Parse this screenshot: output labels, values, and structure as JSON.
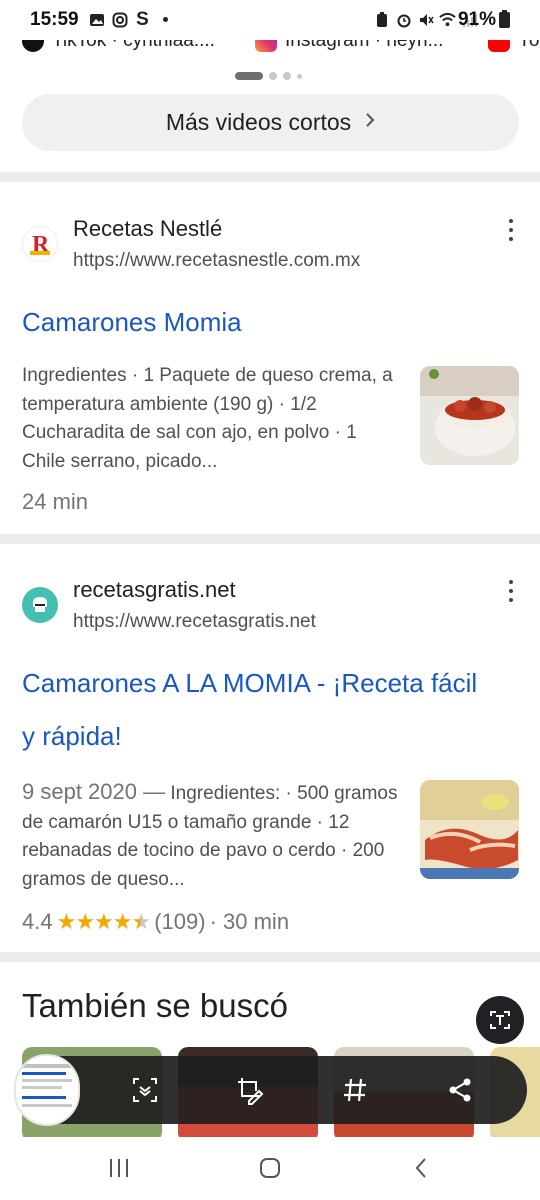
{
  "status_bar": {
    "time": "15:59",
    "battery": "91%"
  },
  "social_row": {
    "items": [
      {
        "label": "TikTok · cynthiaa....",
        "icon": "tiktok-icon"
      },
      {
        "label": "Instagram · neyn...",
        "icon": "instagram-icon"
      },
      {
        "label": "Yo",
        "icon": "youtube-icon"
      }
    ]
  },
  "more_videos": {
    "label": "Más videos cortos"
  },
  "results": [
    {
      "site_name": "Recetas Nestlé",
      "url": "https://www.recetasnestle.com.mx",
      "title": "Camarones Momia",
      "snippet": "Ingredientes · 1 Paquete de queso crema, a temperatura ambiente (190 g) · 1/2 Cucharadita de sal con ajo, en polvo · 1 Chile serrano, picado...",
      "meta": "24 min"
    },
    {
      "site_name": "recetasgratis.net",
      "url": "https://www.recetasgratis.net",
      "title_line1": "Camarones A LA MOMIA - ¡Receta fácil",
      "title_line2": "y rápida!",
      "date": "9 sept 2020 —",
      "snippet": "Ingredientes: · 500 gramos de camarón U15 o tamaño grande · 12 rebanadas de tocino de pavo o cerdo · 200 gramos de queso...",
      "rating": "4.4",
      "reviews": "(109)",
      "duration": "· 30 min"
    }
  ],
  "also_searched": {
    "title": "También se buscó"
  },
  "colors": {
    "link": "#1a57c6",
    "stars": "#f5a700",
    "separator": "#ececec",
    "toolbar": "#1e1e1e"
  }
}
